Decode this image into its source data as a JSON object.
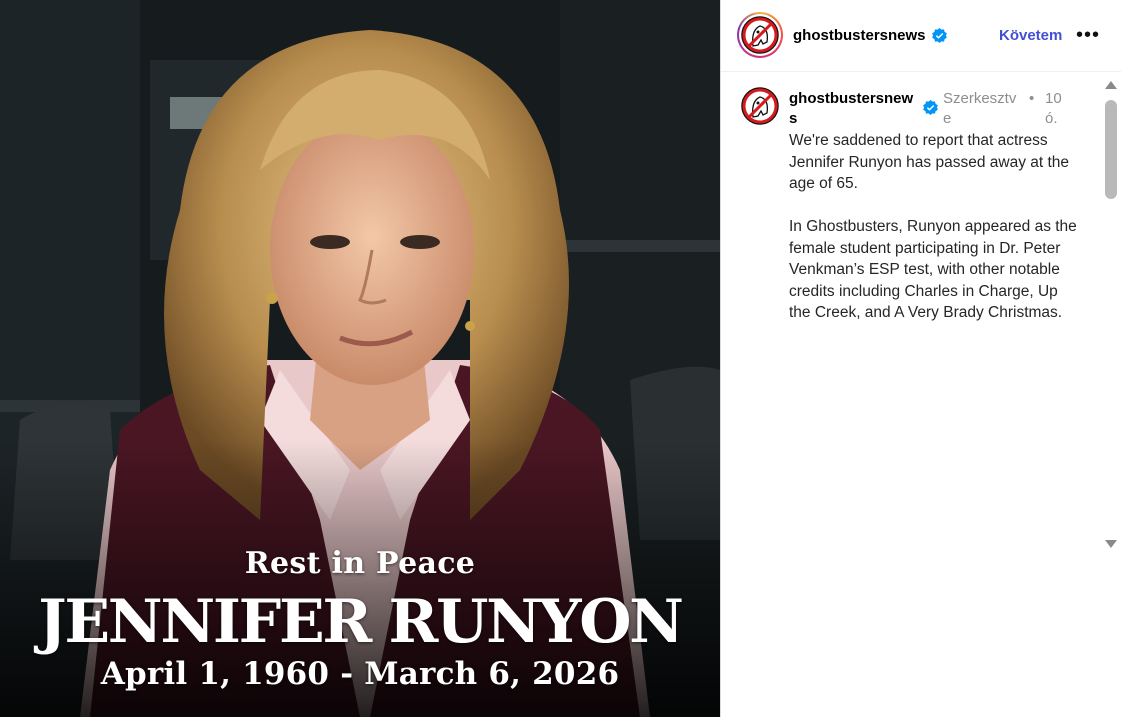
{
  "post_image": {
    "caption_line1": "Rest in Peace",
    "caption_name": "JENNIFER RUNYON",
    "caption_dates": "April 1, 1960 - March 6, 2026"
  },
  "header": {
    "username": "ghostbustersnews",
    "follow_label": "Követem",
    "more_label": "•••",
    "verified_icon": "verified-badge-icon"
  },
  "comment": {
    "username": "ghostbustersnews",
    "edited_label": "Szerkesztve",
    "separator": "•",
    "time": "10 ó.",
    "paragraphs": [
      "We're saddened to report that actress Jennifer Runyon has passed away at the age of 65.",
      "In Ghostbusters, Runyon appeared as the female student participating in Dr. Peter Venkman’s ESP test, with other notable credits including Charles in Charge, Up the Creek, and A Very Brady Christmas."
    ]
  },
  "colors": {
    "follow": "#4150d4",
    "verified": "#0095f6",
    "muted_text": "#8e8e8e"
  }
}
